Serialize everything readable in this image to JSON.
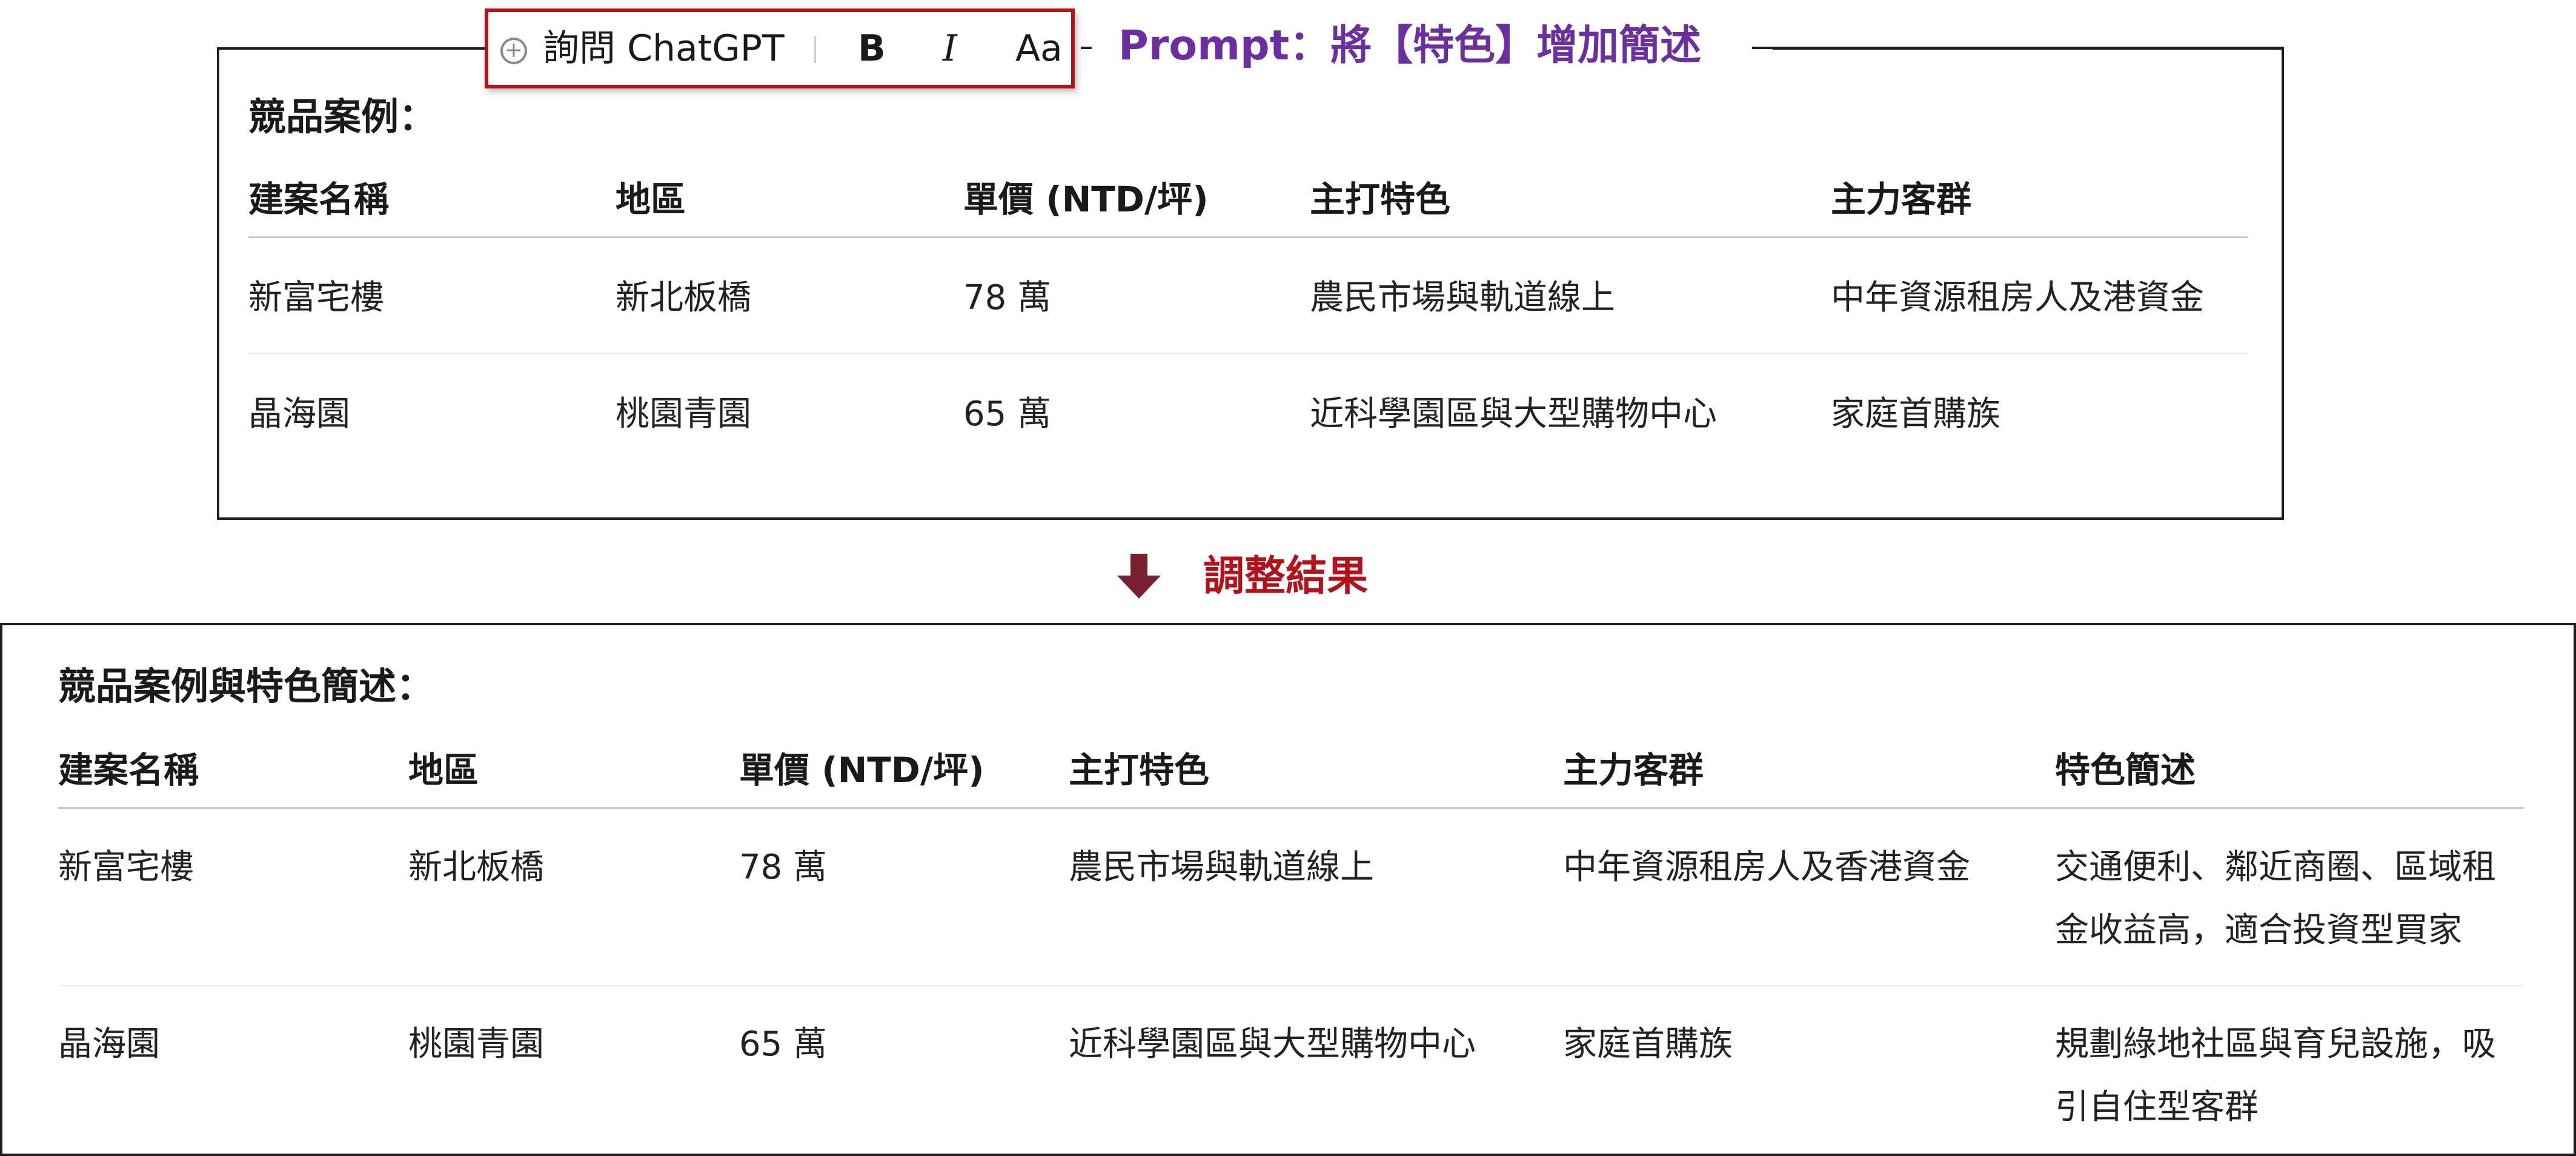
{
  "toolbar": {
    "plus_icon": "plus-circle-icon",
    "ask_label": "詢問 ChatGPT",
    "bold_label": "B",
    "italic_label": "I",
    "case_label": "Aa"
  },
  "prompt": {
    "text": "Prompt：將【特色】增加簡述",
    "color": "#6b2fa0"
  },
  "before": {
    "heading": "競品案例：",
    "columns": [
      "建案名稱",
      "地區",
      "單價 (NTD/坪)",
      "主打特色",
      "主力客群"
    ],
    "rows": [
      [
        "新富宅樓",
        "新北板橋",
        "78 萬",
        "農民市場與軌道線上",
        "中年資源租房人及港資金"
      ],
      [
        "晶海園",
        "桃園青園",
        "65 萬",
        "近科學園區與大型購物中心",
        "家庭首購族"
      ]
    ]
  },
  "transition": {
    "arrow_icon": "down-arrow-icon",
    "label": "調整結果",
    "color": "#b3121b"
  },
  "after": {
    "heading": "競品案例與特色簡述：",
    "columns": [
      "建案名稱",
      "地區",
      "單價 (NTD/坪)",
      "主打特色",
      "主力客群",
      "特色簡述"
    ],
    "rows": [
      [
        "新富宅樓",
        "新北板橋",
        "78 萬",
        "農民市場與軌道線上",
        "中年資源租房人及香港資金",
        "交通便利、鄰近商圈、區域租金收益高，適合投資型買家"
      ],
      [
        "晶海園",
        "桃園青園",
        "65 萬",
        "近科學園區與大型購物中心",
        "家庭首購族",
        "規劃綠地社區與育兒設施，吸引自住型客群"
      ]
    ]
  },
  "colors": {
    "toolbar_border": "#b3121b",
    "panel_border": "#1f1f1f",
    "rule": "#cccccc"
  }
}
